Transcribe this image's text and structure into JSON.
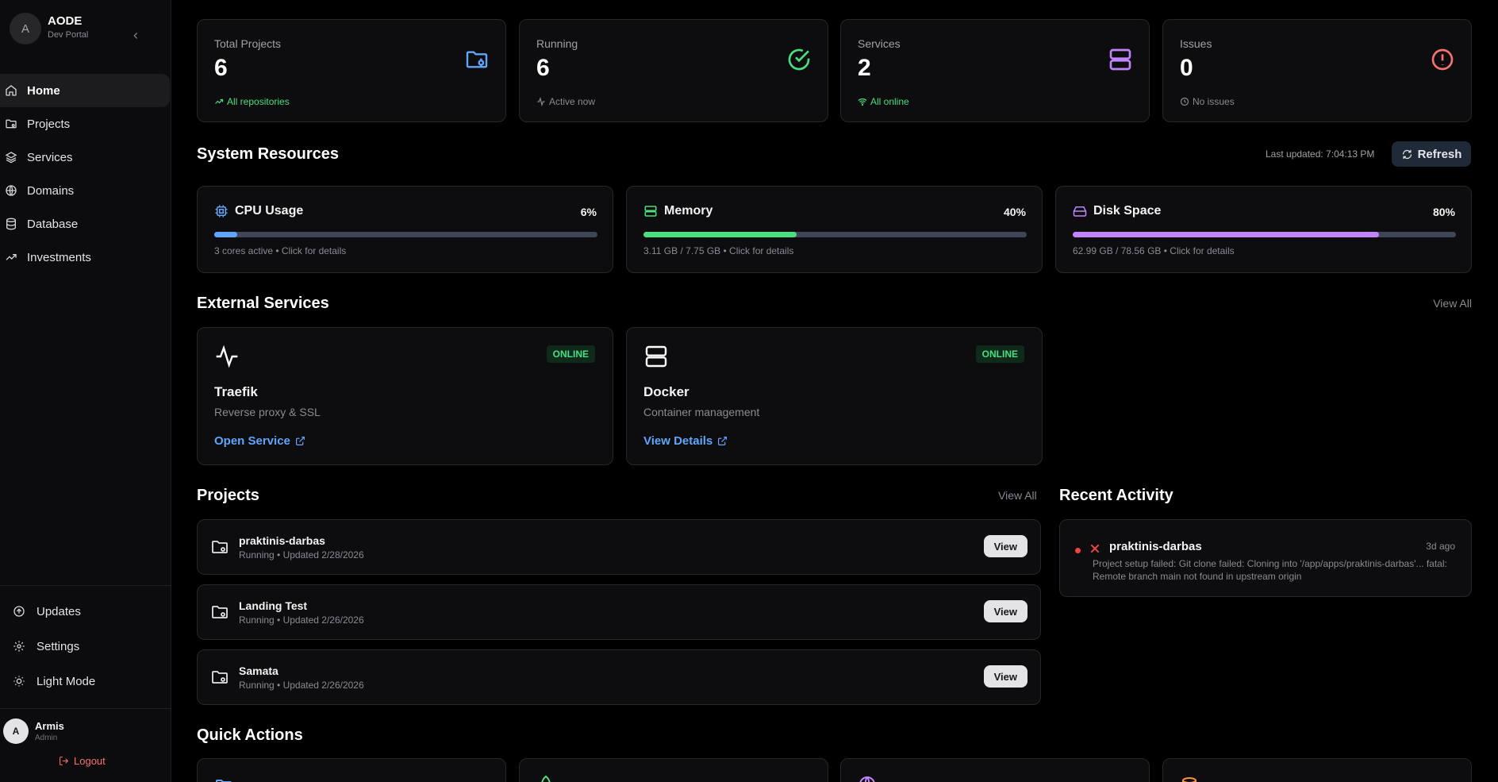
{
  "sidebar": {
    "brand_initial": "A",
    "brand_title": "AODE",
    "brand_subtitle": "Dev Portal",
    "nav": [
      {
        "label": "Home",
        "icon": "home-icon",
        "active": true
      },
      {
        "label": "Projects",
        "icon": "folder-icon"
      },
      {
        "label": "Services",
        "icon": "layers-icon"
      },
      {
        "label": "Domains",
        "icon": "globe-icon"
      },
      {
        "label": "Database",
        "icon": "database-icon"
      },
      {
        "label": "Investments",
        "icon": "trending-up-icon"
      }
    ],
    "bottom": [
      {
        "label": "Updates",
        "icon": "arrow-up-circle-icon"
      },
      {
        "label": "Settings",
        "icon": "gear-icon"
      },
      {
        "label": "Light Mode",
        "icon": "sun-icon"
      }
    ],
    "user": {
      "initial": "A",
      "name": "Armis",
      "role": "Admin",
      "logout": "Logout"
    }
  },
  "stats": [
    {
      "label": "Total Projects",
      "value": "6",
      "foot": "All repositories",
      "foot_color": "#4ade80",
      "icon": "folder-icon",
      "icon_color": "#60a5fa"
    },
    {
      "label": "Running",
      "value": "6",
      "foot": "Active now",
      "foot_color": "#8a8a93",
      "icon": "check-circle-icon",
      "icon_color": "#4ade80"
    },
    {
      "label": "Services",
      "value": "2",
      "foot": "All online",
      "foot_color": "#4ade80",
      "icon": "server-icon",
      "icon_color": "#c084fc"
    },
    {
      "label": "Issues",
      "value": "0",
      "foot": "No issues",
      "foot_color": "#8a8a93",
      "icon": "alert-circle-icon",
      "icon_color": "#f87171"
    }
  ],
  "system": {
    "title": "System Resources",
    "last_updated": "Last updated: 7:04:13 PM",
    "refresh": "Refresh",
    "resources": [
      {
        "name": "CPU Usage",
        "percent_label": "6%",
        "level": 0.06,
        "detail": "3 cores active • Click for details",
        "color": "#60a5fa",
        "icon": "cpu-icon"
      },
      {
        "name": "Memory",
        "percent_label": "40%",
        "level": 0.4,
        "detail": "3.11 GB / 7.75 GB • Click for details",
        "color": "#4ade80",
        "icon": "memory-icon"
      },
      {
        "name": "Disk Space",
        "percent_label": "80%",
        "level": 0.8,
        "detail": "62.99 GB / 78.56 GB • Click for details",
        "color": "#c084fc",
        "icon": "hard-drive-icon"
      }
    ]
  },
  "external": {
    "title": "External Services",
    "view_all": "View All",
    "services": [
      {
        "name": "Traefik",
        "desc": "Reverse proxy & SSL",
        "status": "ONLINE",
        "link": "Open Service",
        "icon": "activity-icon"
      },
      {
        "name": "Docker",
        "desc": "Container management",
        "status": "ONLINE",
        "link": "View Details",
        "icon": "server-icon"
      }
    ]
  },
  "projects": {
    "title": "Projects",
    "view_all": "View All",
    "items": [
      {
        "name": "praktinis-darbas",
        "meta": "Running • Updated 2/28/2026",
        "button": "View"
      },
      {
        "name": "Landing Test",
        "meta": "Running • Updated 2/26/2026",
        "button": "View"
      },
      {
        "name": "Samata",
        "meta": "Running • Updated 2/26/2026",
        "button": "View"
      }
    ]
  },
  "activity": {
    "title": "Recent Activity",
    "items": [
      {
        "name": "praktinis-darbas",
        "time": "3d ago",
        "desc": "Project setup failed: Git clone failed: Cloning into '/app/apps/praktinis-darbas'... fatal: Remote branch main not found in upstream origin"
      }
    ]
  },
  "quick_actions": {
    "title": "Quick Actions"
  }
}
